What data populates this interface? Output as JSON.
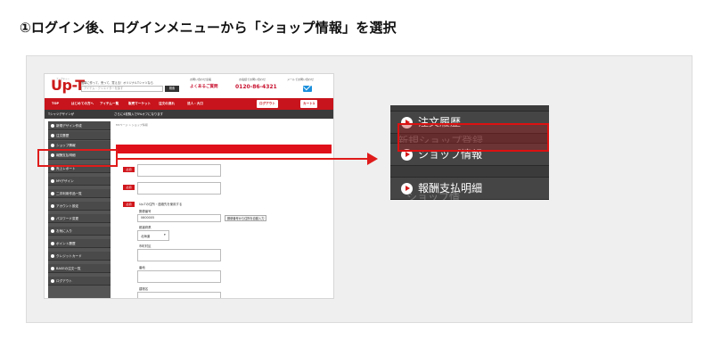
{
  "heading": "①ログイン後、ログインメニューから「ショップ情報」を選択",
  "colors": {
    "accent": "#c8141c",
    "highlight": "#e01b1b",
    "sidebar": "#4a4a4a"
  },
  "site": {
    "logo": "Up-T",
    "logo_sub": "アップティー",
    "tagline": "簡単に作って、売って、買える！オリジナルTシャツなら",
    "search_placeholder": "アイテム・クリエイターを探す",
    "search_button": "検索",
    "contacts": [
      {
        "label": "お問い合わせ全般",
        "value": "よくあるご質問"
      },
      {
        "label": "お電話でお問い合わせ",
        "value": "0120-86-4321"
      },
      {
        "label": "メールでお問い合わせ",
        "value": ""
      }
    ],
    "nav": {
      "items": [
        "TOP",
        "はじめての方へ",
        "アイテム一覧",
        "販売マーケット",
        "注文の流れ",
        "法人・大口"
      ],
      "logout": "ログアウト",
      "cart": "カート1"
    },
    "subbar_text": "Tシャツデザインが",
    "subbar_promo": "さらに4枚購入で5%オフになります",
    "sidebar_items": [
      "新規デザイン作成",
      "注文履歴",
      "ショップ情報",
      "報酬支払明細",
      "売上レポート",
      "MYデザイン",
      "二次利用作品一覧",
      "アカウント設定",
      "パスワード変更",
      "お気に入り",
      "ポイント履歴",
      "クレジットカード",
      "BASEの注文一覧",
      "ログアウト"
    ],
    "breadcrumb": "MYページ > ショップ情報",
    "form": {
      "required": "必須",
      "shop_section_title": "Up-Tの住所・連絡先を使用する",
      "postal_label": "郵便番号",
      "postal_value": "0600005",
      "postal_button": "郵便番号から住所を自動入力",
      "prefecture_label": "都道府県",
      "prefecture_value": "北海道",
      "city_label": "市町村区",
      "town_label": "番地",
      "building_label": "建物名"
    }
  },
  "zoom_menu": {
    "items": [
      "注文履歴",
      "ショップ情報",
      "報酬支払明細"
    ],
    "ghost_top": "新規ショップ登録",
    "ghost_bottom": "ショップ情"
  }
}
